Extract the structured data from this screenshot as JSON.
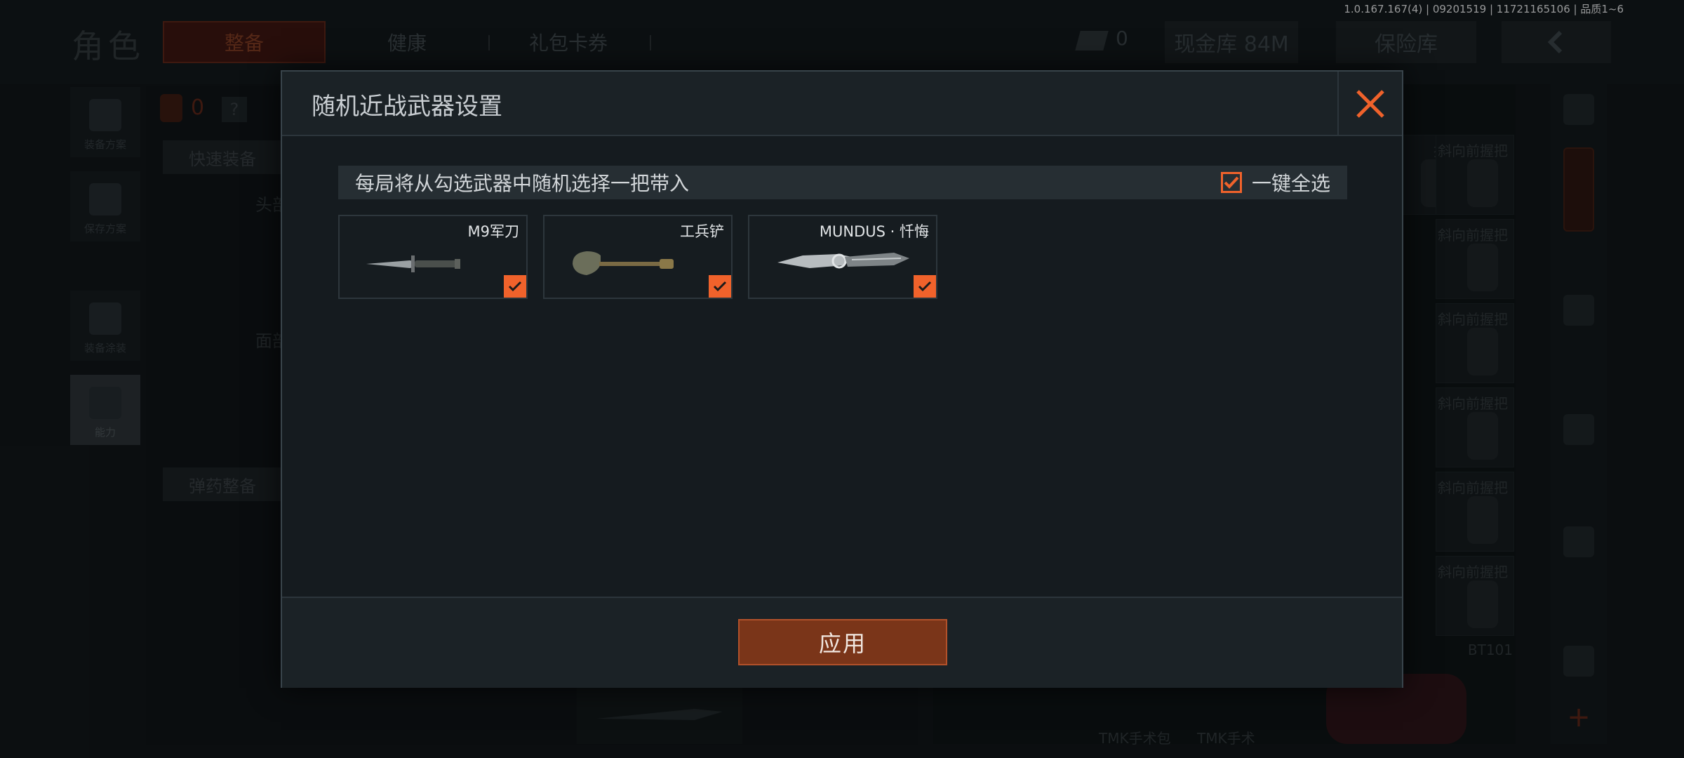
{
  "version_info": "1.0.167.167(4) | 09201519 | 11721165106 | 品质1~6",
  "background": {
    "page_title": "角色",
    "tabs": [
      "整备",
      "健康",
      "礼包卡券"
    ],
    "currency_count": "0",
    "cash_vault": "现金库 84M",
    "safe_vault": "保险库",
    "sidebar": [
      "装备方案",
      "保存方案",
      "装备涂装",
      "能力"
    ],
    "panel_labels": {
      "badge_count": "0",
      "help": "?",
      "quick_equip": "快速装备",
      "head": "头部",
      "face": "面部",
      "ammo": "弹药整备"
    },
    "grid_label": "斜向前握把",
    "grid_label_short": "握把",
    "bottom_item": "BT101",
    "bottom_labels": [
      "TMK手术包",
      "TMK手术"
    ]
  },
  "modal": {
    "title": "随机近战武器设置",
    "instruction": "每局将从勾选武器中随机选择一把带入",
    "select_all_label": "一键全选",
    "select_all_checked": true,
    "weapons": [
      {
        "name": "M9军刀",
        "icon": "bayonet-knife",
        "checked": true
      },
      {
        "name": "工兵铲",
        "icon": "shovel",
        "checked": true
      },
      {
        "name": "MUNDUS · 忏悔",
        "icon": "ornate-knife",
        "checked": true
      }
    ],
    "apply_label": "应用"
  },
  "colors": {
    "accent": "#f0622b",
    "apply_button": "#7a3519"
  }
}
